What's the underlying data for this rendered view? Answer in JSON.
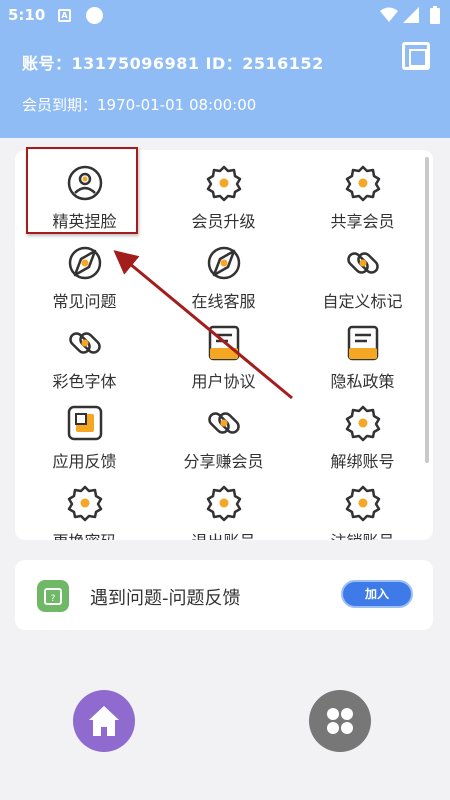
{
  "status_bar": {
    "time": "5:10",
    "indicator": "A"
  },
  "header": {
    "account": "账号：13175096981 ID：2516152",
    "expiry": "会员到期：1970-01-01 08:00:00"
  },
  "grid": [
    {
      "label": "精英捏脸",
      "icon": "user-avatar-icon"
    },
    {
      "label": "会员升级",
      "icon": "gear-icon"
    },
    {
      "label": "共享会员",
      "icon": "gear-icon"
    },
    {
      "label": "常见问题",
      "icon": "compass-icon"
    },
    {
      "label": "在线客服",
      "icon": "compass-icon"
    },
    {
      "label": "自定义标记",
      "icon": "link-icon"
    },
    {
      "label": "彩色字体",
      "icon": "link-icon"
    },
    {
      "label": "用户协议",
      "icon": "document-icon"
    },
    {
      "label": "隐私政策",
      "icon": "document-icon"
    },
    {
      "label": "应用反馈",
      "icon": "feedback-icon"
    },
    {
      "label": "分享赚会员",
      "icon": "link-icon"
    },
    {
      "label": "解绑账号",
      "icon": "gear-icon"
    },
    {
      "label": "更换密码",
      "icon": "gear-icon"
    },
    {
      "label": "退出账号",
      "icon": "gear-icon"
    },
    {
      "label": "注销账号",
      "icon": "gear-icon"
    }
  ],
  "feedback": {
    "text": "遇到问题-问题反馈",
    "button": "加入"
  },
  "colors": {
    "header": "#8fbcf5",
    "accent": "#f5a623",
    "highlight": "#a31d1d",
    "button": "#3f7be8"
  }
}
